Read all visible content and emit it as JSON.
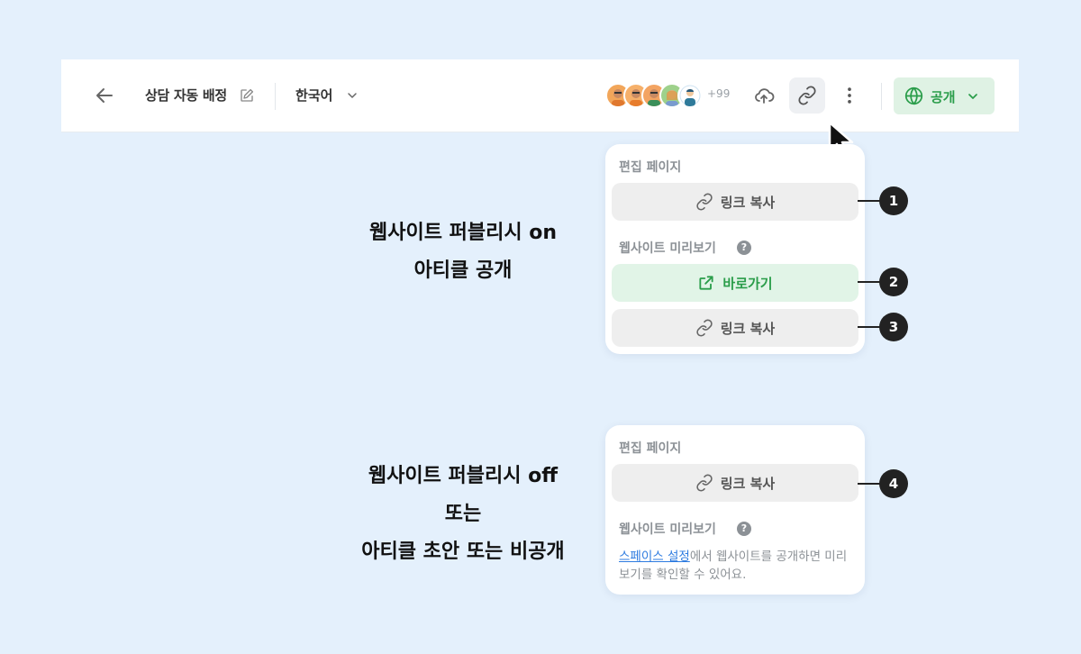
{
  "header": {
    "title": "상담 자동 배정",
    "language": "한국어",
    "avatar_more": "+99",
    "publish_label": "공개",
    "icons": [
      "back-arrow-icon",
      "edit-icon",
      "chevron-down-icon",
      "upload-cloud-icon",
      "link-icon",
      "more-vertical-icon",
      "globe-icon"
    ]
  },
  "captions": {
    "top": [
      "웹사이트 퍼블리시 on",
      "아티클 공개"
    ],
    "bottom": [
      "웹사이트 퍼블리시 off",
      "또는",
      "아티클 초안 또는 비공개"
    ]
  },
  "panel_on": {
    "edit_label": "편집 페이지",
    "copy_link": "링크 복사",
    "preview_label": "웹사이트 미리보기",
    "help_glyph": "?",
    "go_button": "바로가기",
    "copy_link_2": "링크 복사"
  },
  "panel_off": {
    "edit_label": "편집 페이지",
    "copy_link": "링크 복사",
    "preview_label": "웹사이트 미리보기",
    "help_glyph": "?",
    "note_link": "스페이스 설정",
    "note_text": "에서 웹사이트를 공개하면 미리보기를 확인할 수 있어요."
  },
  "markers": [
    "1",
    "2",
    "3",
    "4"
  ],
  "colors": {
    "background": "#e4f0fc",
    "accent_green": "#2a9d4a",
    "link_blue": "#2d7be0"
  }
}
